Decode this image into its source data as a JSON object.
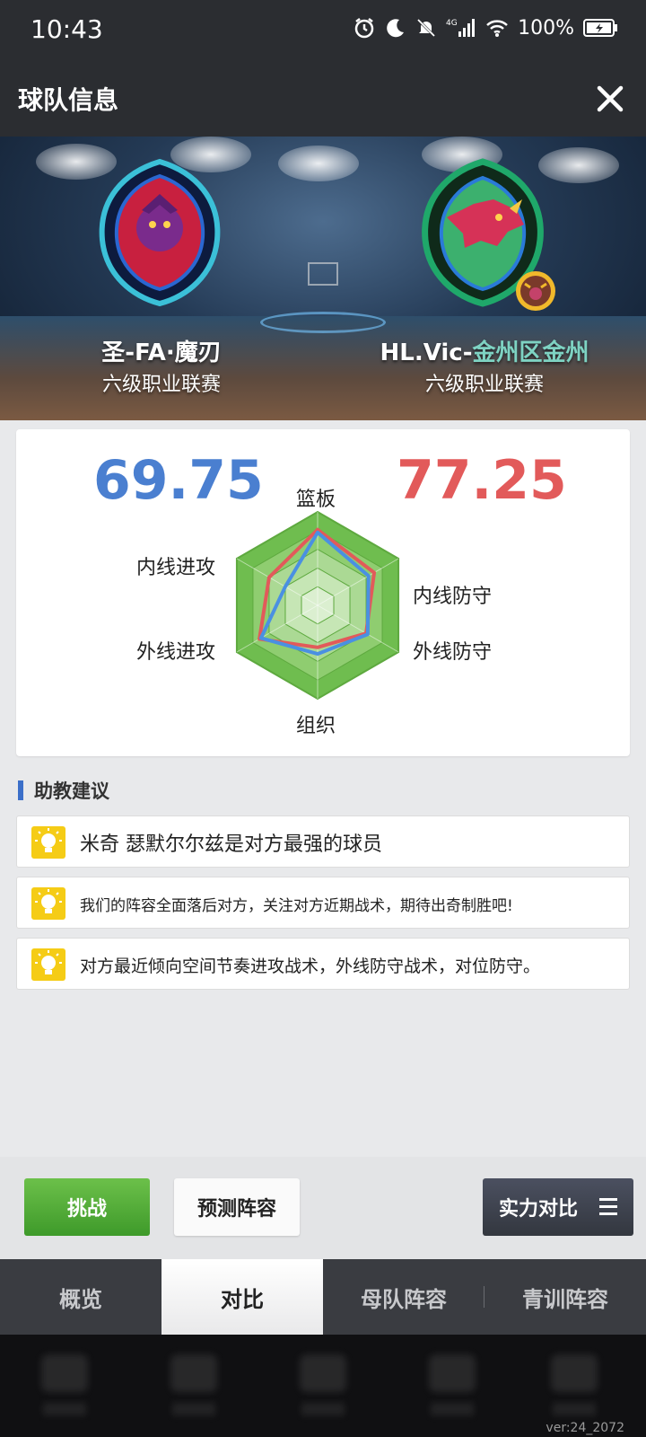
{
  "status_bar": {
    "time": "10:43",
    "network": "4G",
    "battery": "100%"
  },
  "header": {
    "title": "球队信息"
  },
  "banner": {
    "left_team": {
      "name": "圣-FA·魔刃",
      "league": "六级职业联赛"
    },
    "right_team": {
      "name_prefix": "HL.Vic-",
      "name_suffix": "金州区金州",
      "league": "六级职业联赛"
    }
  },
  "comparison": {
    "left_score": "69.75",
    "right_score": "77.25",
    "left_color": "#4a7fd0",
    "right_color": "#e25a5a",
    "axes": [
      "篮板",
      "内线防守",
      "外线防守",
      "组织",
      "外线进攻",
      "内线进攻"
    ]
  },
  "chart_data": {
    "type": "radar",
    "axes": [
      "篮板",
      "内线防守",
      "外线防守",
      "组织",
      "外线进攻",
      "内线进攻"
    ],
    "scale": [
      0,
      1
    ],
    "series": [
      {
        "color": "#4a90e2",
        "values": [
          0.78,
          0.63,
          0.62,
          0.52,
          0.7,
          0.4
        ]
      },
      {
        "color": "#e25a5a",
        "values": [
          0.81,
          0.7,
          0.6,
          0.45,
          0.72,
          0.6
        ]
      }
    ]
  },
  "advice": {
    "title": "助教建议",
    "items": [
      {
        "icon": "lightbulb-icon",
        "text": "米奇 瑟默尔尔兹是对方最强的球员"
      },
      {
        "icon": "lightbulb-icon",
        "text": "我们的阵容全面落后对方，关注对方近期战术，期待出奇制胜吧!"
      },
      {
        "icon": "lightbulb-icon",
        "text": "对方最近倾向空间节奏进攻战术，外线防守战术，对位防守。"
      }
    ]
  },
  "actions": {
    "challenge": "挑战",
    "predict": "预测阵容",
    "compare": "实力对比"
  },
  "tabs": [
    {
      "label": "概览",
      "active": false
    },
    {
      "label": "对比",
      "active": true
    },
    {
      "label": "母队阵容",
      "active": false
    },
    {
      "label": "青训阵容",
      "active": false
    }
  ],
  "footer": {
    "version": "ver:24_2072"
  }
}
